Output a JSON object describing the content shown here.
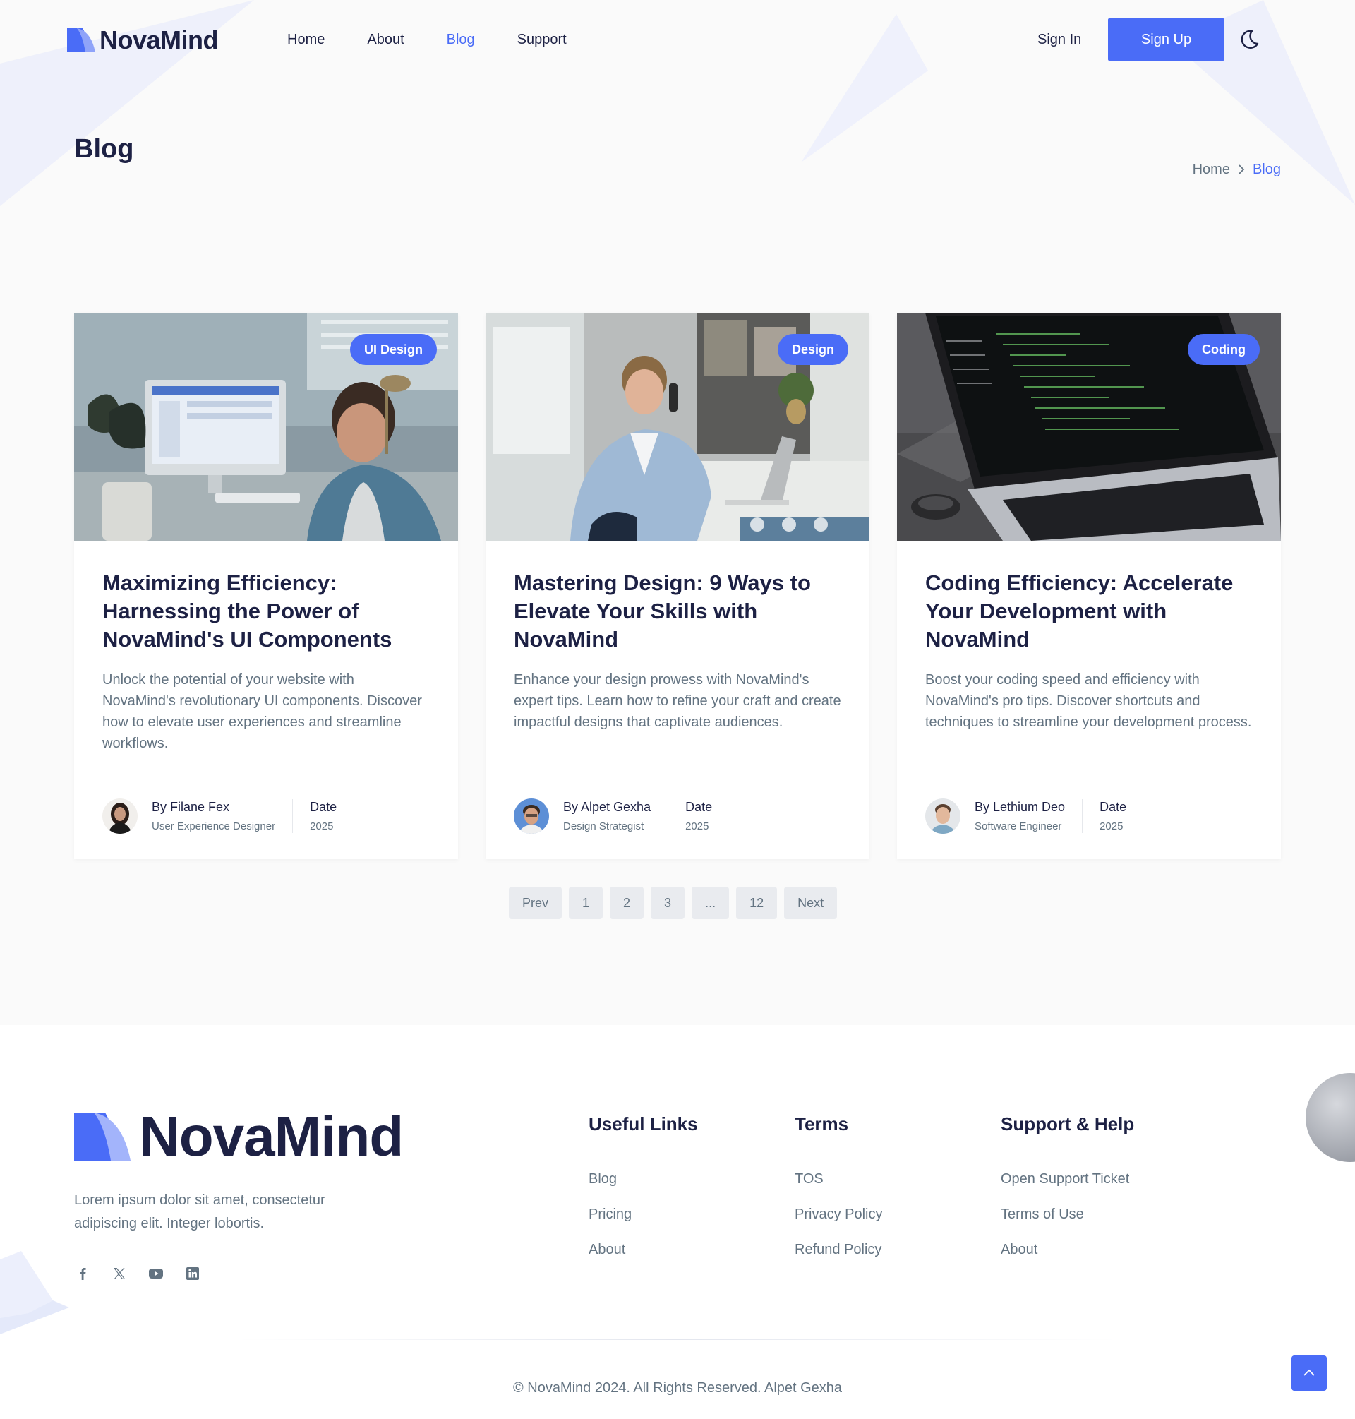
{
  "brand": {
    "name": "NovaMind",
    "accent": "#4a6cf7",
    "accent_light": "#a3b4fb",
    "dark": "#1d2144",
    "muted": "#637381"
  },
  "nav": {
    "items": [
      {
        "label": "Home",
        "active": false
      },
      {
        "label": "About",
        "active": false
      },
      {
        "label": "Blog",
        "active": true
      },
      {
        "label": "Support",
        "active": false
      }
    ],
    "signin_label": "Sign In",
    "signup_label": "Sign Up",
    "theme_icon": "moon-icon"
  },
  "page": {
    "title": "Blog",
    "breadcrumb": {
      "home": "Home",
      "separator_icon": "chevron-right-icon",
      "current": "Blog"
    }
  },
  "posts": [
    {
      "tag": "UI Design",
      "title": "Maximizing Efficiency: Harnessing the Power of NovaMind's UI Components",
      "description": "Unlock the potential of your website with NovaMind's revolutionary UI components. Discover how to elevate user experiences and streamline workflows.",
      "author": "By Filane Fex",
      "role": "User Experience Designer",
      "date_label": "Date",
      "date": "2025"
    },
    {
      "tag": "Design",
      "title": "Mastering Design: 9 Ways to Elevate Your Skills with NovaMind",
      "description": "Enhance your design prowess with NovaMind's expert tips. Learn how to refine your craft and create impactful designs that captivate audiences.",
      "author": "By Alpet Gexha",
      "role": "Design Strategist",
      "date_label": "Date",
      "date": "2025"
    },
    {
      "tag": "Coding",
      "title": "Coding Efficiency: Accelerate Your Development with NovaMind",
      "description": "Boost your coding speed and efficiency with NovaMind's pro tips. Discover shortcuts and techniques to streamline your development process.",
      "author": "By Lethium Deo",
      "role": "Software Engineer",
      "date_label": "Date",
      "date": "2025"
    }
  ],
  "pagination": [
    "Prev",
    "1",
    "2",
    "3",
    "...",
    "12",
    "Next"
  ],
  "footer": {
    "brand": "NovaMind",
    "about": "Lorem ipsum dolor sit amet, consectetur adipiscing elit. Integer lobortis.",
    "socials": [
      "facebook-icon",
      "x-icon",
      "youtube-icon",
      "linkedin-icon"
    ],
    "columns": [
      {
        "title": "Useful Links",
        "links": [
          "Blog",
          "Pricing",
          "About"
        ]
      },
      {
        "title": "Terms",
        "links": [
          "TOS",
          "Privacy Policy",
          "Refund Policy"
        ]
      },
      {
        "title": "Support & Help",
        "links": [
          "Open Support Ticket",
          "Terms of Use",
          "About"
        ]
      }
    ],
    "copyright": "© NovaMind 2024. All Rights Reserved. Alpet Gexha"
  },
  "back_to_top_icon": "chevron-up-icon"
}
